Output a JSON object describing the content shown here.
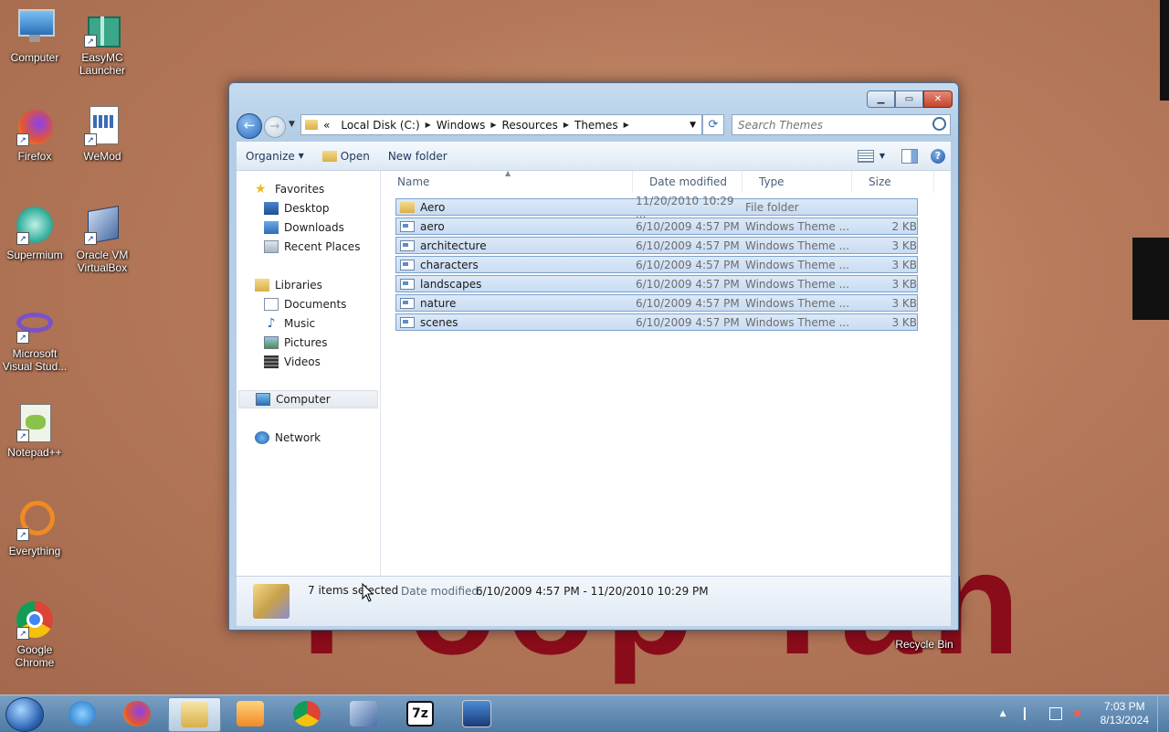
{
  "desktop": {
    "icons": [
      {
        "label": "Computer"
      },
      {
        "label": "EasyMC\nLauncher"
      },
      {
        "label": "Firefox"
      },
      {
        "label": "WeMod"
      },
      {
        "label": "Supermium"
      },
      {
        "label": "Oracle VM\nVirtualBox"
      },
      {
        "label": "Microsoft\nVisual Stud..."
      },
      {
        "label": "Notepad++"
      },
      {
        "label": "Everything"
      },
      {
        "label": "Google\nChrome"
      },
      {
        "label": "Recycle Bin"
      }
    ]
  },
  "explorer": {
    "address": [
      "«",
      "Local Disk (C:)",
      "Windows",
      "Resources",
      "Themes"
    ],
    "search_placeholder": "Search Themes",
    "toolbar": {
      "organize": "Organize",
      "open": "Open",
      "new_folder": "New folder"
    },
    "nav": {
      "favorites": "Favorites",
      "desktop": "Desktop",
      "downloads": "Downloads",
      "recent": "Recent Places",
      "libraries": "Libraries",
      "documents": "Documents",
      "music": "Music",
      "pictures": "Pictures",
      "videos": "Videos",
      "computer": "Computer",
      "network": "Network"
    },
    "columns": {
      "name": "Name",
      "date": "Date modified",
      "type": "Type",
      "size": "Size"
    },
    "files": [
      {
        "name": "Aero",
        "date": "11/20/2010 10:29 ...",
        "type": "File folder",
        "size": "",
        "kind": "folder"
      },
      {
        "name": "aero",
        "date": "6/10/2009 4:57 PM",
        "type": "Windows Theme ...",
        "size": "2 KB",
        "kind": "theme"
      },
      {
        "name": "architecture",
        "date": "6/10/2009 4:57 PM",
        "type": "Windows Theme ...",
        "size": "3 KB",
        "kind": "theme"
      },
      {
        "name": "characters",
        "date": "6/10/2009 4:57 PM",
        "type": "Windows Theme ...",
        "size": "3 KB",
        "kind": "theme"
      },
      {
        "name": "landscapes",
        "date": "6/10/2009 4:57 PM",
        "type": "Windows Theme ...",
        "size": "3 KB",
        "kind": "theme"
      },
      {
        "name": "nature",
        "date": "6/10/2009 4:57 PM",
        "type": "Windows Theme ...",
        "size": "3 KB",
        "kind": "theme"
      },
      {
        "name": "scenes",
        "date": "6/10/2009 4:57 PM",
        "type": "Windows Theme ...",
        "size": "3 KB",
        "kind": "theme"
      }
    ],
    "details": {
      "count": "7 items selected",
      "date_label": "Date modified:",
      "date_value": "6/10/2009 4:57 PM - 11/20/2010 10:29 PM"
    }
  },
  "taskbar": {
    "apps": [
      "start-orb-icon",
      "internet-explorer-icon",
      "firefox-icon",
      "file-explorer-icon",
      "media-player-icon",
      "chrome-icon",
      "virtualbox-icon",
      "7zip-icon",
      "windows-2000-icon"
    ],
    "time": "7:03 PM",
    "date": "8/13/2024"
  },
  "wallpaper_text": "Poop Tan",
  "colors": {
    "accent": "#2a66b8",
    "selection": "#c8dcf3",
    "title": "#8a0c1a"
  }
}
